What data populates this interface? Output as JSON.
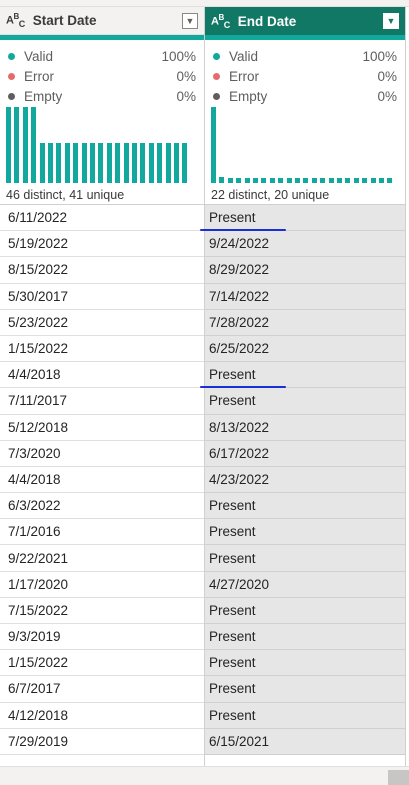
{
  "columns": [
    {
      "type_icon": "ABC",
      "title": "Start Date",
      "stats": [
        {
          "label": "Valid",
          "value": "100%",
          "color": "#13a89e"
        },
        {
          "label": "Error",
          "value": "0%",
          "color": "#e66c6c"
        },
        {
          "label": "Empty",
          "value": "0%",
          "color": "#605e5c"
        }
      ],
      "distribution": [
        1,
        1,
        1,
        1,
        0.52,
        0.52,
        0.52,
        0.52,
        0.52,
        0.52,
        0.52,
        0.52,
        0.52,
        0.52,
        0.52,
        0.52,
        0.52,
        0.52,
        0.52,
        0.52,
        0.52,
        0.52
      ],
      "summary": "46 distinct, 41 unique",
      "values": [
        "6/11/2022",
        "5/19/2022",
        "8/15/2022",
        "5/30/2017",
        "5/23/2022",
        "1/15/2022",
        "4/4/2018",
        "7/11/2017",
        "5/12/2018",
        "7/3/2020",
        "4/4/2018",
        "6/3/2022",
        "7/1/2016",
        "9/22/2021",
        "1/17/2020",
        "7/15/2022",
        "9/3/2019",
        "1/15/2022",
        "6/7/2017",
        "4/12/2018",
        "7/29/2019"
      ]
    },
    {
      "type_icon": "ABC",
      "title": "End Date",
      "stats": [
        {
          "label": "Valid",
          "value": "100%",
          "color": "#13a89e"
        },
        {
          "label": "Error",
          "value": "0%",
          "color": "#e66c6c"
        },
        {
          "label": "Empty",
          "value": "0%",
          "color": "#605e5c"
        }
      ],
      "distribution": [
        1,
        0.08,
        0.06,
        0.06,
        0.06,
        0.06,
        0.06,
        0.06,
        0.06,
        0.06,
        0.06,
        0.06,
        0.06,
        0.06,
        0.06,
        0.06,
        0.06,
        0.06,
        0.06,
        0.06,
        0.06,
        0.06
      ],
      "summary": "22 distinct, 20 unique",
      "values": [
        "Present",
        "9/24/2022",
        "8/29/2022",
        "7/14/2022",
        "7/28/2022",
        "6/25/2022",
        "Present",
        "Present",
        "8/13/2022",
        "6/17/2022",
        "4/23/2022",
        "Present",
        "Present",
        "Present",
        "4/27/2020",
        "Present",
        "Present",
        "Present",
        "Present",
        "Present",
        "6/15/2021"
      ]
    }
  ],
  "annotations": [
    {
      "row": 0,
      "color": "#1a2fd6"
    },
    {
      "row": 6,
      "color": "#1a2fd6"
    }
  ]
}
